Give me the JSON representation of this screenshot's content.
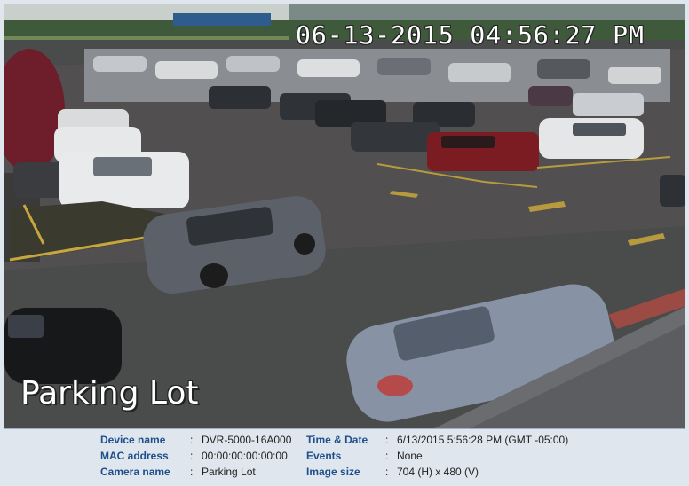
{
  "camera_view": {
    "timestamp_overlay": "06-13-2015 04:56:27 PM",
    "name_overlay": "Parking Lot"
  },
  "info": {
    "colon": ":",
    "device_name": {
      "label": "Device name",
      "value": "DVR-5000-16A000"
    },
    "mac_address": {
      "label": "MAC address",
      "value": "00:00:00:00:00:00"
    },
    "camera_name": {
      "label": "Camera name",
      "value": "Parking Lot"
    },
    "time_date": {
      "label": "Time & Date",
      "value": "6/13/2015 5:56:28 PM (GMT -05:00)"
    },
    "events": {
      "label": "Events",
      "value": "None"
    },
    "image_size": {
      "label": "Image size",
      "value": "704 (H) x 480 (V)"
    }
  },
  "colors": {
    "label_blue": "#1e4f8c",
    "background": "#dfe6ee",
    "overlay_text": "#ffffff"
  }
}
